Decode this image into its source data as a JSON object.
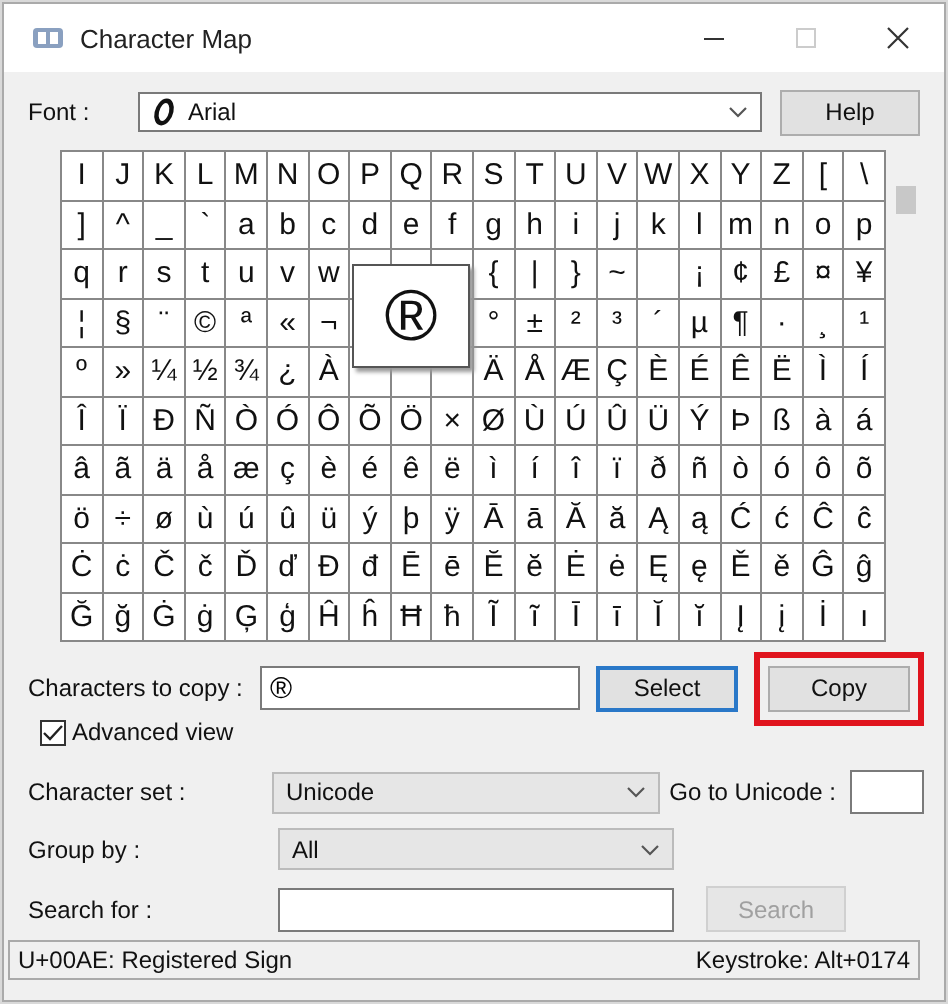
{
  "window": {
    "title": "Character Map"
  },
  "font": {
    "label": "Font :",
    "value": "Arial",
    "help_button": "Help"
  },
  "grid": {
    "rows": [
      [
        "I",
        "J",
        "K",
        "L",
        "M",
        "N",
        "O",
        "P",
        "Q",
        "R",
        "S",
        "T",
        "U",
        "V",
        "W",
        "X",
        "Y",
        "Z",
        "[",
        "\\"
      ],
      [
        "]",
        "^",
        "_",
        "`",
        "a",
        "b",
        "c",
        "d",
        "e",
        "f",
        "g",
        "h",
        "i",
        "j",
        "k",
        "l",
        "m",
        "n",
        "o",
        "p"
      ],
      [
        "q",
        "r",
        "s",
        "t",
        "u",
        "v",
        "w",
        null,
        null,
        null,
        "{",
        "|",
        "}",
        "~",
        null,
        "¡",
        "¢",
        "£",
        "¤",
        "¥"
      ],
      [
        "¦",
        "§",
        "¨",
        "©",
        "ª",
        "«",
        "¬",
        null,
        null,
        null,
        "°",
        "±",
        "²",
        "³",
        "´",
        "µ",
        "¶",
        "·",
        "¸",
        "¹"
      ],
      [
        "º",
        "»",
        "¼",
        "½",
        "¾",
        "¿",
        "À",
        null,
        null,
        null,
        "Ä",
        "Å",
        "Æ",
        "Ç",
        "È",
        "É",
        "Ê",
        "Ë",
        "Ì",
        "Í"
      ],
      [
        "Î",
        "Ï",
        "Ð",
        "Ñ",
        "Ò",
        "Ó",
        "Ô",
        "Õ",
        "Ö",
        "×",
        "Ø",
        "Ù",
        "Ú",
        "Û",
        "Ü",
        "Ý",
        "Þ",
        "ß",
        "à",
        "á"
      ],
      [
        "â",
        "ã",
        "ä",
        "å",
        "æ",
        "ç",
        "è",
        "é",
        "ê",
        "ë",
        "ì",
        "í",
        "î",
        "ï",
        "ð",
        "ñ",
        "ò",
        "ó",
        "ô",
        "õ"
      ],
      [
        "ö",
        "÷",
        "ø",
        "ù",
        "ú",
        "û",
        "ü",
        "ý",
        "þ",
        "ÿ",
        "Ā",
        "ā",
        "Ă",
        "ă",
        "Ą",
        "ą",
        "Ć",
        "ć",
        "Ĉ",
        "ĉ"
      ],
      [
        "Ċ",
        "ċ",
        "Č",
        "č",
        "Ď",
        "ď",
        "Đ",
        "đ",
        "Ē",
        "ē",
        "Ĕ",
        "ĕ",
        "Ė",
        "ė",
        "Ę",
        "ę",
        "Ě",
        "ě",
        "Ĝ",
        "ĝ"
      ],
      [
        "Ğ",
        "ğ",
        "Ġ",
        "ġ",
        "Ģ",
        "ģ",
        "Ĥ",
        "ĥ",
        "Ħ",
        "ħ",
        "Ĩ",
        "ĩ",
        "Ī",
        "ī",
        "Ĭ",
        "ĭ",
        "Į",
        "į",
        "İ",
        "ı"
      ]
    ],
    "enlarged": "®"
  },
  "copy_row": {
    "label": "Characters to copy :",
    "value": "®",
    "buttons": [
      {
        "label": "Select",
        "focused": true,
        "highlighted": false
      },
      {
        "label": "Copy",
        "focused": false,
        "highlighted": true
      }
    ]
  },
  "advanced_view": {
    "label": "Advanced view",
    "checked": true
  },
  "character_set": {
    "label": "Character set :",
    "value": "Unicode"
  },
  "go_to_unicode": {
    "label": "Go to Unicode :"
  },
  "group_by": {
    "label": "Group by :",
    "value": "All"
  },
  "search": {
    "label": "Search for :",
    "button": "Search",
    "disabled": true
  },
  "status_bar": {
    "description": "U+00AE: Registered Sign",
    "keystroke": "Keystroke: Alt+0174"
  }
}
